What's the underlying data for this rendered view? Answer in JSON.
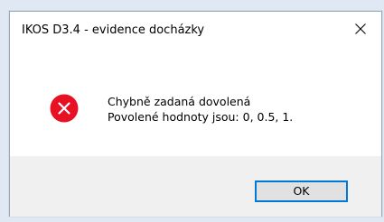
{
  "window": {
    "title": "IKOS D3.4 - evidence docházky"
  },
  "icons": {
    "close": "close-icon",
    "error": "error-icon"
  },
  "message": {
    "line1": "Chybně zadaná dovolená",
    "line2": "Povolené hodnoty jsou: 0, 0.5, 1."
  },
  "buttons": {
    "ok_label": "OK"
  },
  "colors": {
    "error_red": "#e81123",
    "focus_border": "#0078d7",
    "button_area": "#f0f0f0"
  }
}
